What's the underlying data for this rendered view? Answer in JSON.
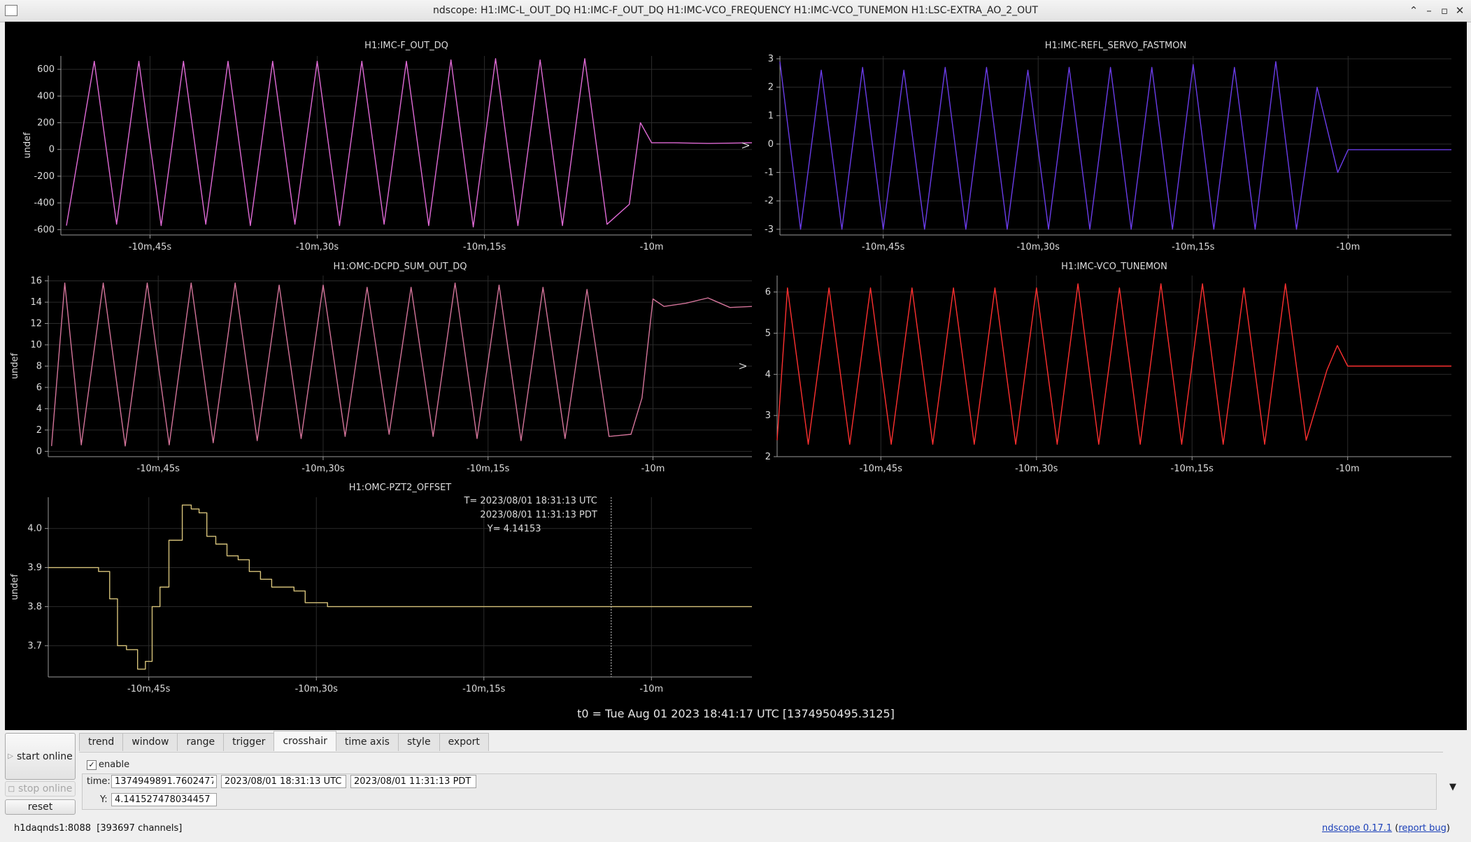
{
  "window": {
    "title": "ndscope: H1:IMC-L_OUT_DQ H1:IMC-F_OUT_DQ H1:IMC-VCO_FREQUENCY H1:IMC-VCO_TUNEMON H1:LSC-EXTRA_AO_2_OUT",
    "icons": [
      "minimize-icon",
      "maximize-icon",
      "restore-icon",
      "close-icon"
    ]
  },
  "plots": {
    "p1": {
      "title": "H1:IMC-F_OUT_DQ",
      "ylabel": "undef",
      "color": "#e06ad6",
      "yticks": [
        {
          "v": 600,
          "t": "600"
        },
        {
          "v": 400,
          "t": "400"
        },
        {
          "v": 200,
          "t": "200"
        },
        {
          "v": 0,
          "t": "0"
        },
        {
          "v": -200,
          "t": "-200"
        },
        {
          "v": -400,
          "t": "-400"
        },
        {
          "v": -600,
          "t": "-600"
        }
      ],
      "xticks": [
        {
          "v": -645,
          "t": "-10m,45s"
        },
        {
          "v": -630,
          "t": "-10m,30s"
        },
        {
          "v": -615,
          "t": "-10m,15s"
        },
        {
          "v": -600,
          "t": "-10m"
        }
      ]
    },
    "p2": {
      "title": "H1:IMC-REFL_SERVO_FASTMON",
      "ylabel": "V",
      "color": "#6a3ce8",
      "yticks": [
        {
          "v": 3,
          "t": "3"
        },
        {
          "v": 2,
          "t": "2"
        },
        {
          "v": 1,
          "t": "1"
        },
        {
          "v": 0,
          "t": "0"
        },
        {
          "v": -1,
          "t": "-1"
        },
        {
          "v": -2,
          "t": "-2"
        },
        {
          "v": -3,
          "t": "-3"
        }
      ],
      "xticks": [
        {
          "v": -645,
          "t": "-10m,45s"
        },
        {
          "v": -630,
          "t": "-10m,30s"
        },
        {
          "v": -615,
          "t": "-10m,15s"
        },
        {
          "v": -600,
          "t": "-10m"
        }
      ]
    },
    "p3": {
      "title": "H1:OMC-DCPD_SUM_OUT_DQ",
      "ylabel": "undef",
      "color": "#d4749a",
      "yticks": [
        {
          "v": 16,
          "t": "16"
        },
        {
          "v": 14,
          "t": "14"
        },
        {
          "v": 12,
          "t": "12"
        },
        {
          "v": 10,
          "t": "10"
        },
        {
          "v": 8,
          "t": "8"
        },
        {
          "v": 6,
          "t": "6"
        },
        {
          "v": 4,
          "t": "4"
        },
        {
          "v": 2,
          "t": "2"
        },
        {
          "v": 0,
          "t": "0"
        }
      ],
      "xticks": [
        {
          "v": -645,
          "t": "-10m,45s"
        },
        {
          "v": -630,
          "t": "-10m,30s"
        },
        {
          "v": -615,
          "t": "-10m,15s"
        },
        {
          "v": -600,
          "t": "-10m"
        }
      ]
    },
    "p4": {
      "title": "H1:IMC-VCO_TUNEMON",
      "ylabel": "V",
      "color": "#ff3030",
      "yticks": [
        {
          "v": 6,
          "t": "6"
        },
        {
          "v": 5,
          "t": "5"
        },
        {
          "v": 4,
          "t": "4"
        },
        {
          "v": 3,
          "t": "3"
        },
        {
          "v": 2,
          "t": "2"
        }
      ],
      "xticks": [
        {
          "v": -645,
          "t": "-10m,45s"
        },
        {
          "v": -630,
          "t": "-10m,30s"
        },
        {
          "v": -615,
          "t": "-10m,15s"
        },
        {
          "v": -600,
          "t": "-10m"
        }
      ]
    },
    "p5": {
      "title": "H1:OMC-PZT2_OFFSET",
      "ylabel": "undef",
      "color": "#d6c27a",
      "yticks": [
        {
          "v": 4.0,
          "t": "4.0"
        },
        {
          "v": 3.9,
          "t": "3.9"
        },
        {
          "v": 3.8,
          "t": "3.8"
        },
        {
          "v": 3.7,
          "t": "3.7"
        }
      ],
      "xticks": [
        {
          "v": -645,
          "t": "-10m,45s"
        },
        {
          "v": -630,
          "t": "-10m,30s"
        },
        {
          "v": -615,
          "t": "-10m,15s"
        },
        {
          "v": -600,
          "t": "-10m"
        }
      ],
      "crosshair": {
        "x": -603.6,
        "line1": "T= 2023/08/01 18:31:13 UTC",
        "line2": "2023/08/01 11:31:13 PDT",
        "line3": "Y= 4.14153"
      }
    }
  },
  "chart_data": [
    {
      "type": "line",
      "title": "H1:IMC-F_OUT_DQ",
      "ylabel": "undef",
      "xlim": [
        -653,
        -591
      ],
      "ylim": [
        -640,
        700
      ],
      "x": [
        -652.5,
        -650,
        -648,
        -646,
        -644,
        -642,
        -640,
        -638,
        -636,
        -634,
        -632,
        -630,
        -628,
        -626,
        -624,
        -622,
        -620,
        -618,
        -616,
        -614,
        -612,
        -610,
        -608,
        -606,
        -604,
        -602,
        -601,
        -600,
        -598,
        -595,
        -591
      ],
      "y": [
        -570,
        660,
        -560,
        660,
        -570,
        660,
        -560,
        660,
        -570,
        660,
        -560,
        660,
        -570,
        660,
        -560,
        660,
        -570,
        670,
        -580,
        680,
        -570,
        670,
        -570,
        680,
        -560,
        -410,
        200,
        50,
        50,
        45,
        50
      ]
    },
    {
      "type": "line",
      "title": "H1:IMC-REFL_SERVO_FASTMON",
      "ylabel": "V",
      "xlim": [
        -655,
        -590
      ],
      "ylim": [
        -3.2,
        3.1
      ],
      "x": [
        -655,
        -653,
        -651,
        -649,
        -647,
        -645,
        -643,
        -641,
        -639,
        -637,
        -635,
        -633,
        -631,
        -629,
        -627,
        -625,
        -623,
        -621,
        -619,
        -617,
        -615,
        -613,
        -611,
        -609,
        -607,
        -605,
        -603,
        -601,
        -600,
        -597,
        -590
      ],
      "y": [
        2.9,
        -3.0,
        2.6,
        -3.0,
        2.7,
        -3.0,
        2.6,
        -3.0,
        2.7,
        -3.0,
        2.7,
        -3.0,
        2.6,
        -3.0,
        2.7,
        -3.0,
        2.7,
        -3.0,
        2.7,
        -3.0,
        2.8,
        -3.0,
        2.7,
        -3.0,
        2.9,
        -3.0,
        2.0,
        -1.0,
        -0.2,
        -0.2,
        -0.2
      ]
    },
    {
      "type": "line",
      "title": "H1:OMC-DCPD_SUM_OUT_DQ",
      "ylabel": "undef",
      "xlim": [
        -655,
        -591
      ],
      "ylim": [
        -0.5,
        16.5
      ],
      "x": [
        -654.7,
        -653.5,
        -652,
        -650,
        -648,
        -646,
        -644,
        -642,
        -640,
        -638,
        -636,
        -634,
        -632,
        -630,
        -628,
        -626,
        -624,
        -622,
        -620,
        -618,
        -616,
        -614,
        -612,
        -610,
        -608,
        -606,
        -604,
        -602,
        -601,
        -600,
        -599,
        -597,
        -595,
        -593,
        -591
      ],
      "y": [
        0.5,
        15.8,
        0.6,
        15.8,
        0.5,
        15.8,
        0.6,
        15.8,
        0.8,
        15.8,
        1.0,
        15.6,
        1.2,
        15.6,
        1.4,
        15.4,
        1.6,
        15.4,
        1.4,
        15.8,
        1.2,
        15.6,
        1.0,
        15.4,
        1.2,
        15.2,
        1.4,
        1.6,
        5,
        14.3,
        13.6,
        13.9,
        14.4,
        13.5,
        13.6
      ]
    },
    {
      "type": "line",
      "title": "H1:IMC-VCO_TUNEMON",
      "ylabel": "V",
      "xlim": [
        -655,
        -590
      ],
      "ylim": [
        2,
        6.4
      ],
      "x": [
        -655,
        -654,
        -652,
        -650,
        -648,
        -646,
        -644,
        -642,
        -640,
        -638,
        -636,
        -634,
        -632,
        -630,
        -628,
        -626,
        -624,
        -622,
        -620,
        -618,
        -616,
        -614,
        -612,
        -610,
        -608,
        -606,
        -604,
        -602,
        -601,
        -600,
        -597,
        -590
      ],
      "y": [
        2.4,
        6.1,
        2.3,
        6.1,
        2.3,
        6.1,
        2.3,
        6.1,
        2.3,
        6.1,
        2.3,
        6.1,
        2.3,
        6.1,
        2.3,
        6.2,
        2.3,
        6.1,
        2.3,
        6.2,
        2.3,
        6.2,
        2.3,
        6.1,
        2.3,
        6.2,
        2.4,
        4.1,
        4.7,
        4.2,
        4.2,
        4.2
      ]
    },
    {
      "type": "line",
      "title": "H1:OMC-PZT2_OFFSET",
      "ylabel": "undef",
      "xlim": [
        -654,
        -591
      ],
      "ylim": [
        3.62,
        4.08
      ],
      "x": [
        -654,
        -651,
        -649.5,
        -648.5,
        -647.8,
        -647,
        -646,
        -645.3,
        -644.7,
        -644,
        -643.2,
        -642,
        -641.2,
        -640.5,
        -639.8,
        -639,
        -638,
        -637,
        -636,
        -635,
        -634,
        -633,
        -632,
        -631,
        -629,
        -600,
        -591
      ],
      "y": [
        3.9,
        3.9,
        3.89,
        3.82,
        3.7,
        3.69,
        3.64,
        3.66,
        3.8,
        3.85,
        3.97,
        4.06,
        4.05,
        4.04,
        3.98,
        3.96,
        3.93,
        3.92,
        3.89,
        3.87,
        3.85,
        3.85,
        3.84,
        3.81,
        3.8,
        3.8,
        3.8
      ]
    }
  ],
  "t0_label": "t0 = Tue Aug 01 2023 18:41:17 UTC [1374950495.3125]",
  "controls": {
    "start_online": "start online",
    "stop_online": "stop online",
    "reset": "reset",
    "tabs": [
      "trend",
      "window",
      "range",
      "trigger",
      "crosshair",
      "time axis",
      "style",
      "export"
    ],
    "active_tab": "crosshair",
    "enable_label": "enable",
    "enable_checked": "✓",
    "time_label": "time:",
    "time_gps": "1374949891.7602477",
    "time_utc": "2023/08/01 18:31:13 UTC",
    "time_pdt": "2023/08/01 11:31:13 PDT",
    "y_label": "Y:",
    "y_value": "4.141527478034457",
    "expand_glyph": "▼"
  },
  "status": {
    "server": "h1daqnds1:8088",
    "channels": "[393697 channels]",
    "version": "ndscope 0.17.1",
    "report": "report bug"
  }
}
